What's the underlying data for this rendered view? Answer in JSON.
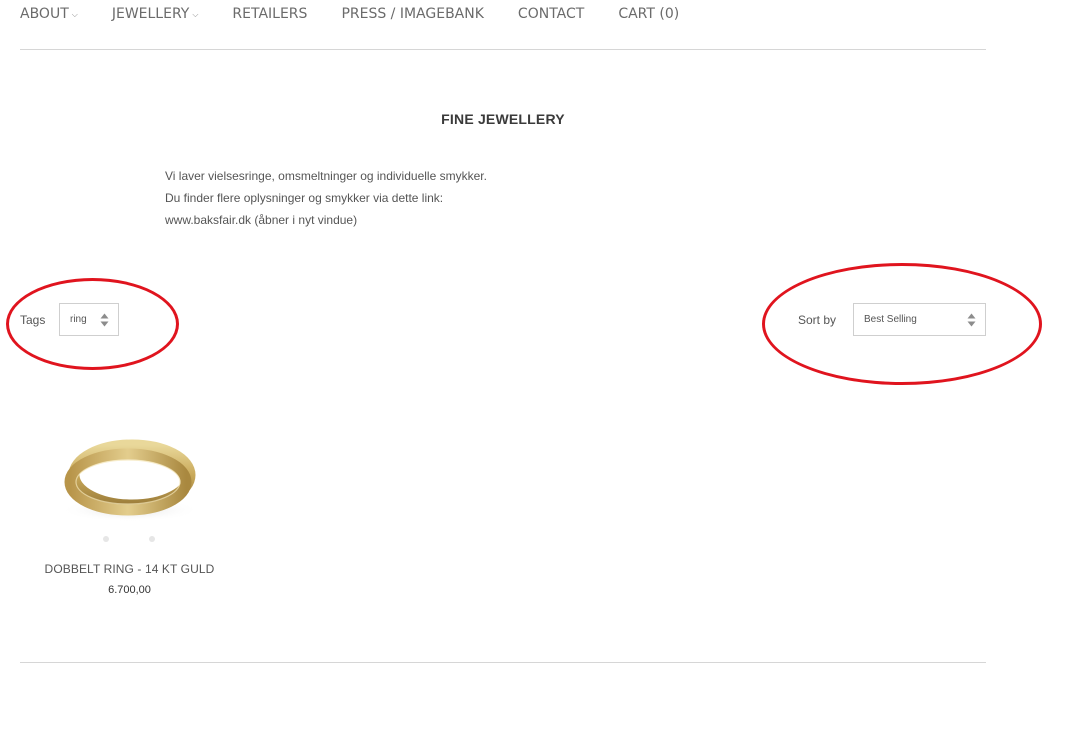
{
  "nav": {
    "items": [
      {
        "label": "ABOUT",
        "dropdown": true
      },
      {
        "label": "JEWELLERY",
        "dropdown": true
      },
      {
        "label": "RETAILERS",
        "dropdown": false
      },
      {
        "label": "PRESS / IMAGEBANK",
        "dropdown": false
      },
      {
        "label": "CONTACT",
        "dropdown": false
      },
      {
        "label": "CART (0)",
        "dropdown": false
      }
    ],
    "chevron": "⌵"
  },
  "collection": {
    "title": "FINE JEWELLERY",
    "description": [
      "Vi laver vielsesringe, omsmeltninger og individuelle smykker.",
      "Du finder flere oplysninger og smykker via dette link:",
      "www.baksfair.dk (åbner i nyt vindue)"
    ]
  },
  "filters": {
    "tags_label": "Tags",
    "tags_value": "ring",
    "sort_label": "Sort by",
    "sort_value": "Best Selling"
  },
  "annotations": {
    "color": "#e0141e"
  },
  "products": [
    {
      "name": "DOBBELT RING - 14 KT GULD",
      "price": "6.700,00",
      "image": "gold-double-ring"
    }
  ]
}
